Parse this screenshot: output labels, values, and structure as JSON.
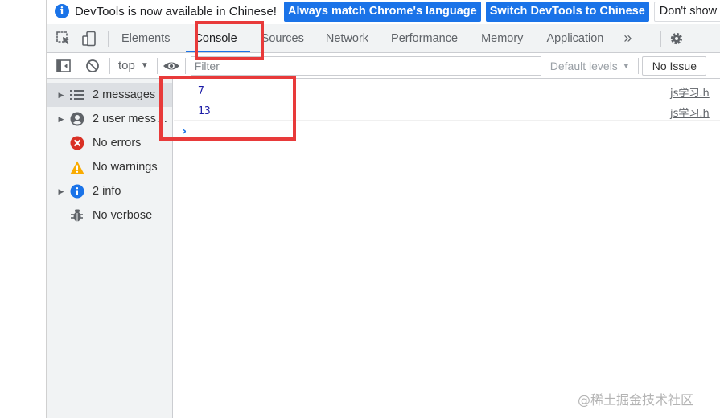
{
  "infobar": {
    "message": "DevTools is now available in Chinese!",
    "match_button": "Always match Chrome's language",
    "switch_button": "Switch DevTools to Chinese",
    "dont_show_button": "Don't show aga"
  },
  "tabs": [
    {
      "label": "Elements"
    },
    {
      "label": "Console",
      "active": true
    },
    {
      "label": "Sources"
    },
    {
      "label": "Network"
    },
    {
      "label": "Performance"
    },
    {
      "label": "Memory"
    },
    {
      "label": "Application"
    }
  ],
  "tabbar": {
    "more": "»"
  },
  "console_toolbar": {
    "context": "top",
    "filter_placeholder": "Filter",
    "levels": "Default levels",
    "issues": "No Issue"
  },
  "sidebar": {
    "items": [
      {
        "label": "2 messages",
        "icon": "list-icon",
        "expandable": true,
        "selected": true
      },
      {
        "label": "2 user mess…",
        "icon": "user-icon",
        "expandable": true
      },
      {
        "label": "No errors",
        "icon": "error-icon",
        "expandable": false
      },
      {
        "label": "No warnings",
        "icon": "warning-icon",
        "expandable": false
      },
      {
        "label": "2 info",
        "icon": "info-icon",
        "expandable": true
      },
      {
        "label": "No verbose",
        "icon": "bug-icon",
        "expandable": false
      }
    ]
  },
  "console": {
    "messages": [
      {
        "value": "7",
        "source": "js学习.h"
      },
      {
        "value": "13",
        "source": "js学习.h"
      }
    ],
    "prompt": "›"
  },
  "watermark": "@稀土掘金技术社区",
  "colors": {
    "accent": "#1a73e8",
    "annotation": "#e83a3a",
    "error": "#d93025",
    "warning": "#f9ab00"
  }
}
